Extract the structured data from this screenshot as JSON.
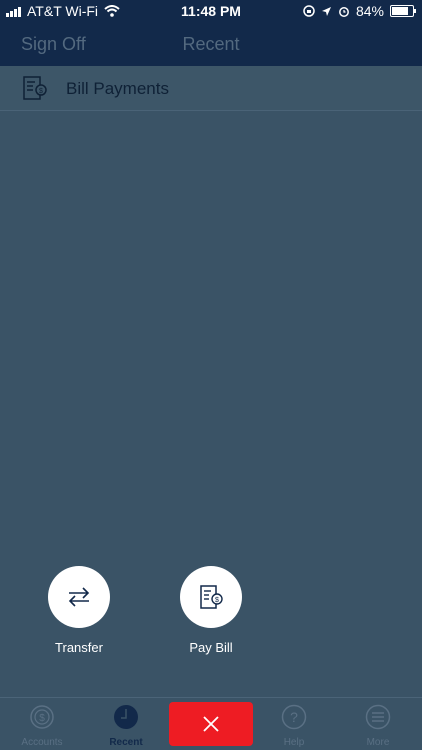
{
  "status": {
    "carrier": "AT&T Wi-Fi",
    "time": "11:48 PM",
    "battery": "84%",
    "icons": [
      "signal-icon",
      "wifi-icon",
      "screen-lock-icon",
      "location-icon",
      "alarm-icon",
      "battery-icon"
    ]
  },
  "header": {
    "sign_off": "Sign Off",
    "title": "Recent"
  },
  "recent": {
    "items": [
      {
        "label": "Bill Payments",
        "icon": "bill-document-icon"
      }
    ]
  },
  "actions": [
    {
      "label": "Transfer",
      "icon": "transfer-arrows-icon"
    },
    {
      "label": "Pay Bill",
      "icon": "pay-bill-icon"
    }
  ],
  "tabbar": {
    "accounts": "Accounts",
    "recent": "Recent",
    "help": "Help",
    "more": "More",
    "close_icon": "close-icon"
  },
  "colors": {
    "header_bg": "#12294a",
    "overlay_bg": "#3a5366",
    "accent_red": "#ee1c23"
  }
}
